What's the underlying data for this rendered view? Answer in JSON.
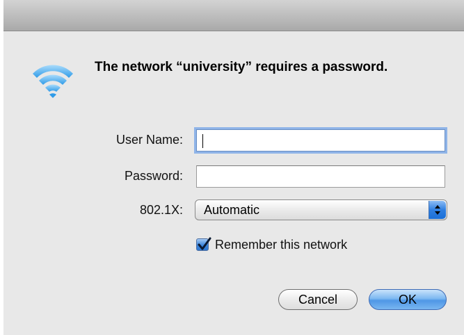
{
  "dialog": {
    "message": "The network “university” requires a password.",
    "icon": "wifi-icon"
  },
  "form": {
    "username": {
      "label": "User Name:",
      "value": "",
      "placeholder": ""
    },
    "password": {
      "label": "Password:",
      "value": "",
      "placeholder": ""
    },
    "security": {
      "label": "802.1X:",
      "selected": "Automatic"
    },
    "remember": {
      "label": "Remember this network",
      "checked": true
    }
  },
  "buttons": {
    "cancel": "Cancel",
    "ok": "OK"
  },
  "colors": {
    "accent": "#3d86dc",
    "wifi_blue": "#2f9be8"
  }
}
